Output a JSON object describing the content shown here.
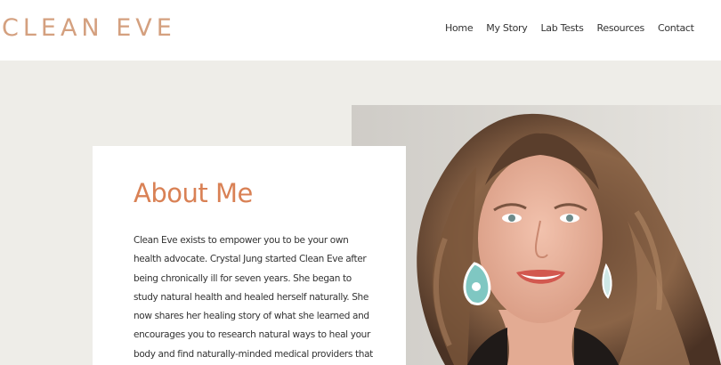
{
  "header": {
    "logo": "CLEAN EVE",
    "nav": [
      "Home",
      "My Story",
      "Lab Tests",
      "Resources",
      "Contact"
    ]
  },
  "about": {
    "title": "About Me",
    "lines": [
      "Clean Eve exists to empower you to be your own",
      "health advocate. Crystal Jung started Clean Eve after",
      "being chronically ill for seven years. She began to",
      "study natural health and healed herself naturally. She",
      "now shares her healing story of what she learned and",
      "encourages you to research natural ways to heal your",
      "body and find naturally-minded medical providers that"
    ]
  },
  "colors": {
    "logo": "#d4a07f",
    "heading": "#d98155",
    "band": "#eeede8"
  }
}
